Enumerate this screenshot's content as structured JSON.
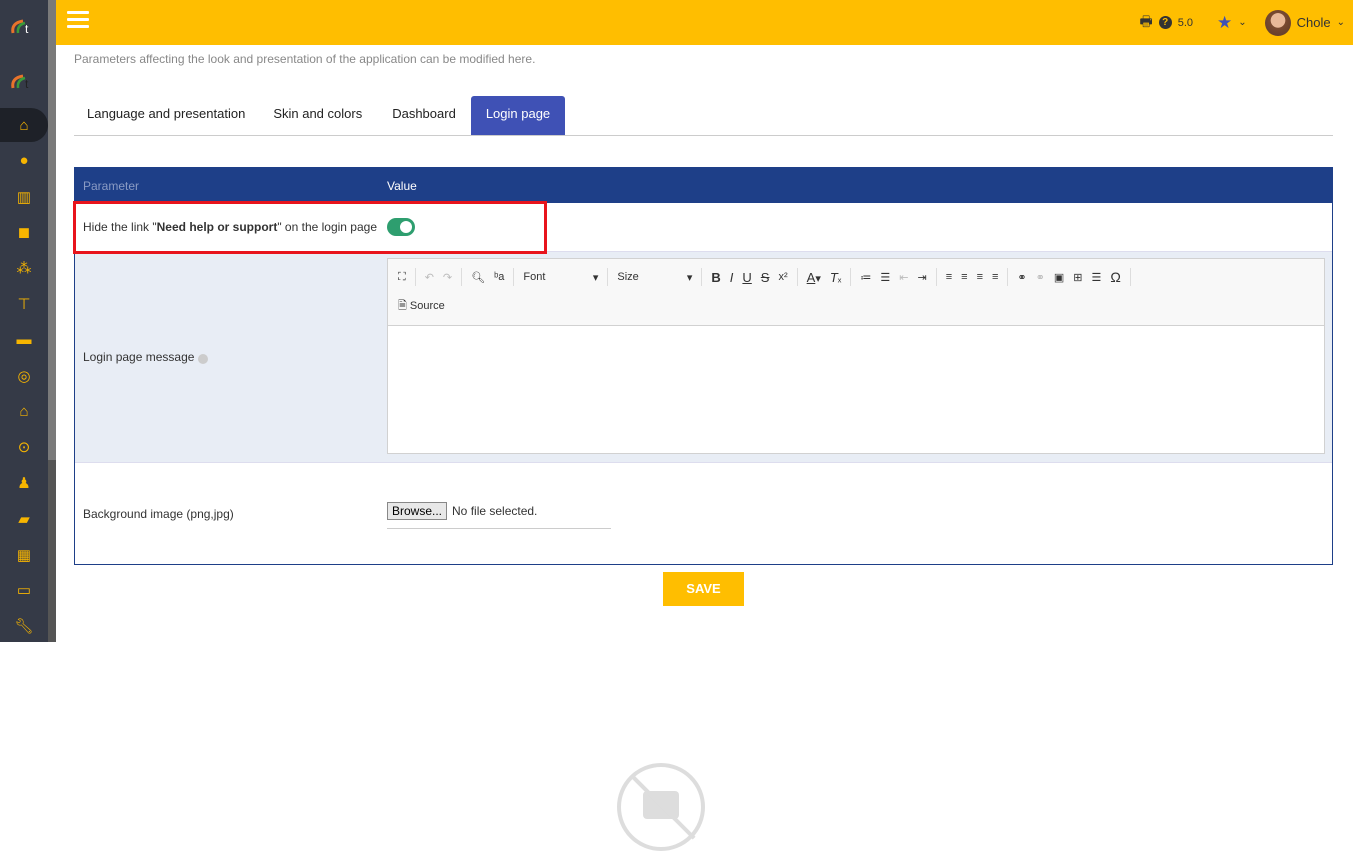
{
  "header": {
    "version": "5.0",
    "user": "Chole",
    "accent": "#ffbe00"
  },
  "description": "Parameters affecting the look and presentation of the application can be modified here.",
  "tabs": [
    {
      "label": "Language and presentation"
    },
    {
      "label": "Skin and colors"
    },
    {
      "label": "Dashboard"
    },
    {
      "label": "Login page",
      "active": true
    }
  ],
  "table": {
    "col_parameter": "Parameter",
    "col_value": "Value",
    "rows": {
      "hide_link": {
        "pre": "Hide the link \"",
        "bold": "Need help or support",
        "post": "\" on the login page",
        "value": true
      },
      "message": {
        "label": "Login page message"
      },
      "background": {
        "label": "Background image (png,jpg)",
        "browse": "Browse...",
        "file_status": "No file selected."
      }
    }
  },
  "editor": {
    "font": "Font",
    "size": "Size",
    "source": "Source"
  },
  "save_label": "SAVE",
  "sidebar": {
    "icons": [
      "home-icon",
      "user-icon",
      "building-icon",
      "box-icon",
      "boxes-icon",
      "sitemap-icon",
      "briefcase-icon",
      "coins-icon",
      "bank-icon",
      "search-dollar-icon",
      "user-tie-icon",
      "folder-open-icon",
      "calendar-icon",
      "ticket-icon",
      "wrench-icon"
    ]
  }
}
